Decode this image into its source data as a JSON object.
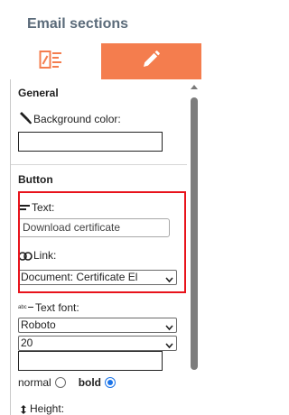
{
  "panel": {
    "title": "Email sections",
    "tabs": [
      {
        "icon": "layout-icon",
        "active": false
      },
      {
        "icon": "pencil-icon",
        "active": true
      }
    ],
    "accent_color": "#f47d4e",
    "highlight_color": "#e8131b"
  },
  "general": {
    "heading": "General",
    "background_color_label": "Background color:",
    "background_color_value": ""
  },
  "button": {
    "heading": "Button",
    "text_label": "Text:",
    "text_value": "Download certificate",
    "link_label": "Link:",
    "link_value": "Document: Certificate El",
    "text_font_label": "Text font:",
    "font_family": "Roboto",
    "font_size": "20",
    "font_color_value": "",
    "weight_normal_label": "normal",
    "weight_bold_label": "bold",
    "weight_selected": "bold",
    "height_label": "Height:"
  }
}
